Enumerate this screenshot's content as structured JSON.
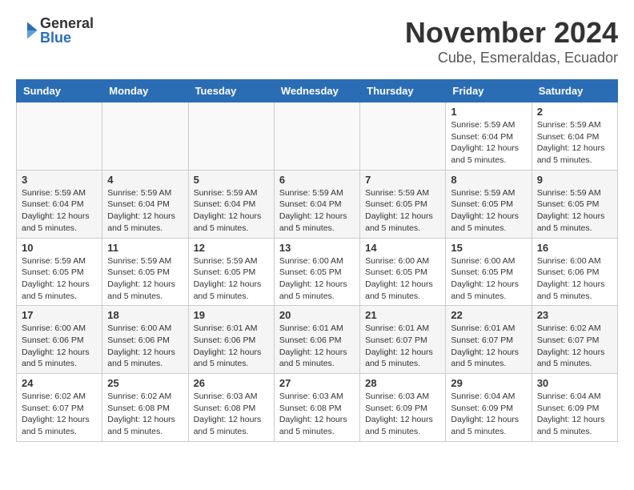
{
  "logo": {
    "general": "General",
    "blue": "Blue"
  },
  "title": {
    "month": "November 2024",
    "location": "Cube, Esmeraldas, Ecuador"
  },
  "headers": [
    "Sunday",
    "Monday",
    "Tuesday",
    "Wednesday",
    "Thursday",
    "Friday",
    "Saturday"
  ],
  "weeks": [
    [
      {
        "day": "",
        "info": ""
      },
      {
        "day": "",
        "info": ""
      },
      {
        "day": "",
        "info": ""
      },
      {
        "day": "",
        "info": ""
      },
      {
        "day": "",
        "info": ""
      },
      {
        "day": "1",
        "info": "Sunrise: 5:59 AM\nSunset: 6:04 PM\nDaylight: 12 hours and 5 minutes."
      },
      {
        "day": "2",
        "info": "Sunrise: 5:59 AM\nSunset: 6:04 PM\nDaylight: 12 hours and 5 minutes."
      }
    ],
    [
      {
        "day": "3",
        "info": "Sunrise: 5:59 AM\nSunset: 6:04 PM\nDaylight: 12 hours and 5 minutes."
      },
      {
        "day": "4",
        "info": "Sunrise: 5:59 AM\nSunset: 6:04 PM\nDaylight: 12 hours and 5 minutes."
      },
      {
        "day": "5",
        "info": "Sunrise: 5:59 AM\nSunset: 6:04 PM\nDaylight: 12 hours and 5 minutes."
      },
      {
        "day": "6",
        "info": "Sunrise: 5:59 AM\nSunset: 6:04 PM\nDaylight: 12 hours and 5 minutes."
      },
      {
        "day": "7",
        "info": "Sunrise: 5:59 AM\nSunset: 6:05 PM\nDaylight: 12 hours and 5 minutes."
      },
      {
        "day": "8",
        "info": "Sunrise: 5:59 AM\nSunset: 6:05 PM\nDaylight: 12 hours and 5 minutes."
      },
      {
        "day": "9",
        "info": "Sunrise: 5:59 AM\nSunset: 6:05 PM\nDaylight: 12 hours and 5 minutes."
      }
    ],
    [
      {
        "day": "10",
        "info": "Sunrise: 5:59 AM\nSunset: 6:05 PM\nDaylight: 12 hours and 5 minutes."
      },
      {
        "day": "11",
        "info": "Sunrise: 5:59 AM\nSunset: 6:05 PM\nDaylight: 12 hours and 5 minutes."
      },
      {
        "day": "12",
        "info": "Sunrise: 5:59 AM\nSunset: 6:05 PM\nDaylight: 12 hours and 5 minutes."
      },
      {
        "day": "13",
        "info": "Sunrise: 6:00 AM\nSunset: 6:05 PM\nDaylight: 12 hours and 5 minutes."
      },
      {
        "day": "14",
        "info": "Sunrise: 6:00 AM\nSunset: 6:05 PM\nDaylight: 12 hours and 5 minutes."
      },
      {
        "day": "15",
        "info": "Sunrise: 6:00 AM\nSunset: 6:05 PM\nDaylight: 12 hours and 5 minutes."
      },
      {
        "day": "16",
        "info": "Sunrise: 6:00 AM\nSunset: 6:06 PM\nDaylight: 12 hours and 5 minutes."
      }
    ],
    [
      {
        "day": "17",
        "info": "Sunrise: 6:00 AM\nSunset: 6:06 PM\nDaylight: 12 hours and 5 minutes."
      },
      {
        "day": "18",
        "info": "Sunrise: 6:00 AM\nSunset: 6:06 PM\nDaylight: 12 hours and 5 minutes."
      },
      {
        "day": "19",
        "info": "Sunrise: 6:01 AM\nSunset: 6:06 PM\nDaylight: 12 hours and 5 minutes."
      },
      {
        "day": "20",
        "info": "Sunrise: 6:01 AM\nSunset: 6:06 PM\nDaylight: 12 hours and 5 minutes."
      },
      {
        "day": "21",
        "info": "Sunrise: 6:01 AM\nSunset: 6:07 PM\nDaylight: 12 hours and 5 minutes."
      },
      {
        "day": "22",
        "info": "Sunrise: 6:01 AM\nSunset: 6:07 PM\nDaylight: 12 hours and 5 minutes."
      },
      {
        "day": "23",
        "info": "Sunrise: 6:02 AM\nSunset: 6:07 PM\nDaylight: 12 hours and 5 minutes."
      }
    ],
    [
      {
        "day": "24",
        "info": "Sunrise: 6:02 AM\nSunset: 6:07 PM\nDaylight: 12 hours and 5 minutes."
      },
      {
        "day": "25",
        "info": "Sunrise: 6:02 AM\nSunset: 6:08 PM\nDaylight: 12 hours and 5 minutes."
      },
      {
        "day": "26",
        "info": "Sunrise: 6:03 AM\nSunset: 6:08 PM\nDaylight: 12 hours and 5 minutes."
      },
      {
        "day": "27",
        "info": "Sunrise: 6:03 AM\nSunset: 6:08 PM\nDaylight: 12 hours and 5 minutes."
      },
      {
        "day": "28",
        "info": "Sunrise: 6:03 AM\nSunset: 6:09 PM\nDaylight: 12 hours and 5 minutes."
      },
      {
        "day": "29",
        "info": "Sunrise: 6:04 AM\nSunset: 6:09 PM\nDaylight: 12 hours and 5 minutes."
      },
      {
        "day": "30",
        "info": "Sunrise: 6:04 AM\nSunset: 6:09 PM\nDaylight: 12 hours and 5 minutes."
      }
    ]
  ]
}
